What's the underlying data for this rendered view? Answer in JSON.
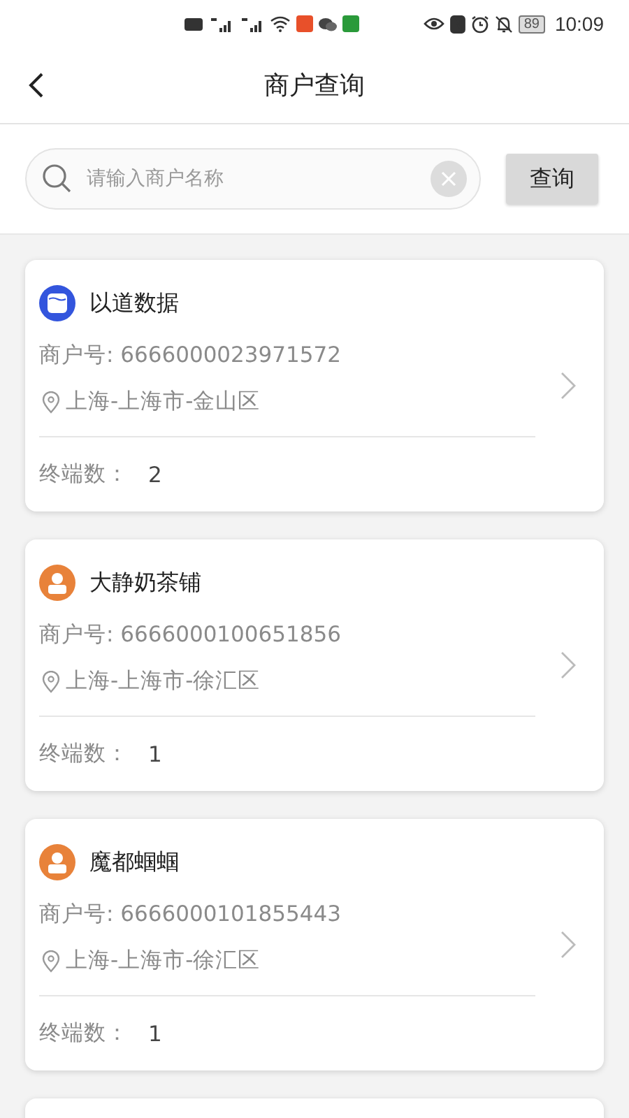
{
  "status_bar": {
    "battery": "89",
    "time": "10:09"
  },
  "header": {
    "title": "商户查询"
  },
  "search": {
    "placeholder": "请输入商户名称",
    "button": "查询"
  },
  "merchants": [
    {
      "name": "以道数据",
      "kind": "data",
      "color": "#3355dd",
      "merchant_no": "商户号: 6666000023971572",
      "location": "上海-上海市-金山区",
      "terminals_label": "终端数：",
      "terminals": "2"
    },
    {
      "name": "大静奶茶铺",
      "kind": "person",
      "color": "#e8823a",
      "merchant_no": "商户号: 6666000100651856",
      "location": "上海-上海市-徐汇区",
      "terminals_label": "终端数：",
      "terminals": "1"
    },
    {
      "name": "魔都蝈蝈",
      "kind": "person",
      "color": "#e8823a",
      "merchant_no": "商户号: 6666000101855443",
      "location": "上海-上海市-徐汇区",
      "terminals_label": "终端数：",
      "terminals": "1"
    }
  ]
}
